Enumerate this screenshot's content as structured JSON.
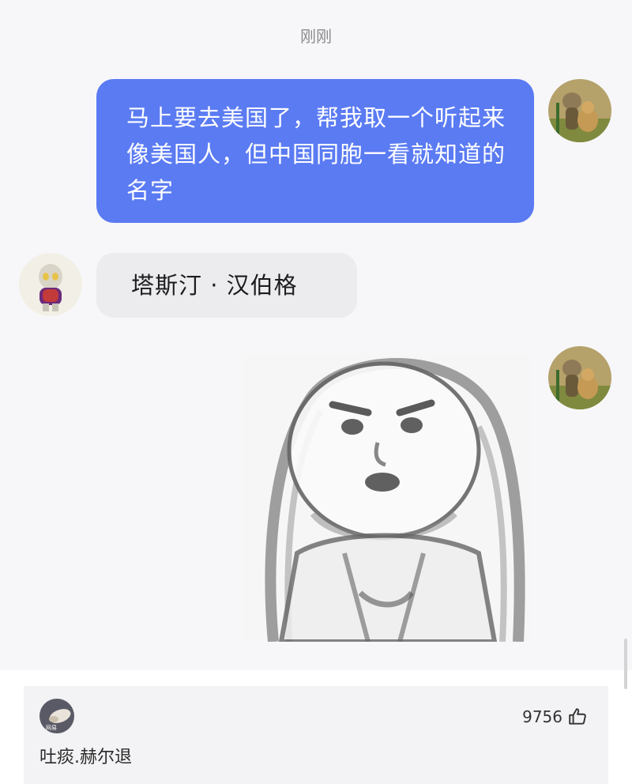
{
  "timestamp": "刚刚",
  "messages": [
    {
      "direction": "outgoing",
      "text": "马上要去美国了，帮我取一个听起来像美国人，但中国同胞一看就知道的名字"
    },
    {
      "direction": "incoming",
      "text": "塔斯汀 · 汉伯格"
    },
    {
      "direction": "outgoing",
      "type": "sticker",
      "sticker": "shocked-sketch-face-sticker"
    }
  ],
  "comment": {
    "username": "吐痰.赫尔退",
    "avatar_badge": "网易",
    "likes": "9756",
    "like_icon": "thumbs-up-icon"
  },
  "colors": {
    "outgoing_bubble": "#5b7bf3",
    "incoming_bubble": "#ececef",
    "chat_background": "#f7f7f9"
  }
}
